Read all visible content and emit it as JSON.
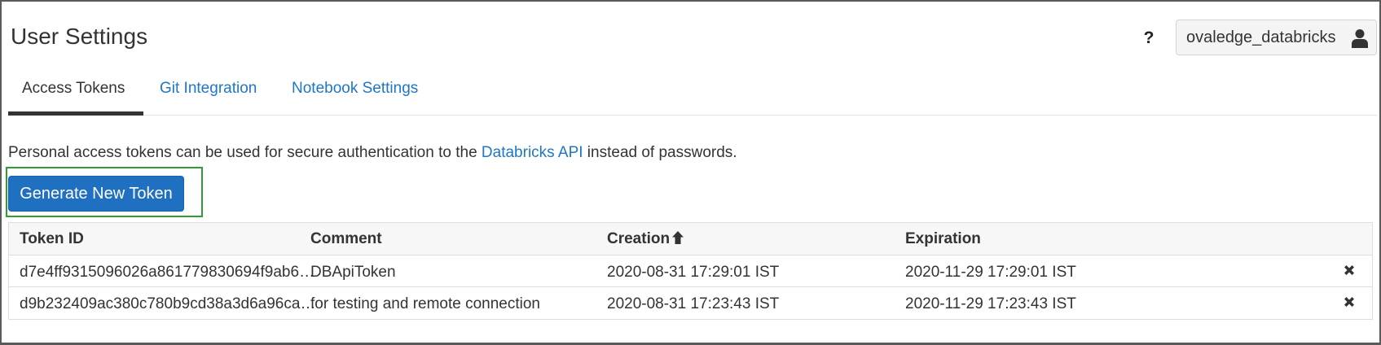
{
  "page": {
    "title": "User Settings",
    "help_label": "?",
    "user_name": "ovaledge_databricks"
  },
  "tabs": [
    {
      "label": "Access Tokens",
      "active": true
    },
    {
      "label": "Git Integration",
      "active": false
    },
    {
      "label": "Notebook Settings",
      "active": false
    }
  ],
  "description": {
    "before": "Personal access tokens can be used for secure authentication to the ",
    "link": "Databricks API",
    "after": " instead of passwords."
  },
  "generate_button_label": "Generate New Token",
  "table": {
    "columns": [
      "Token ID",
      "Comment",
      "Creation",
      "Expiration"
    ],
    "sort_column": "Creation",
    "sort_direction": "ascending",
    "rows": [
      {
        "token_id": "d7e4ff9315096026a861779830694f9ab6…",
        "comment": "DBApiToken",
        "creation": "2020-08-31 17:29:01 IST",
        "expiration": "2020-11-29 17:29:01 IST"
      },
      {
        "token_id": "d9b232409ac380c780b9cd38a3d6a96ca…",
        "comment": "for testing and remote connection",
        "creation": "2020-08-31 17:23:43 IST",
        "expiration": "2020-11-29 17:23:43 IST"
      }
    ]
  },
  "colors": {
    "link": "#1f76c6",
    "primary_button": "#1f70c1",
    "highlight": "#2e9e2e",
    "text": "#333333"
  },
  "icons": [
    "help-icon",
    "user-icon",
    "sort-arrow-up-icon",
    "delete-icon"
  ]
}
